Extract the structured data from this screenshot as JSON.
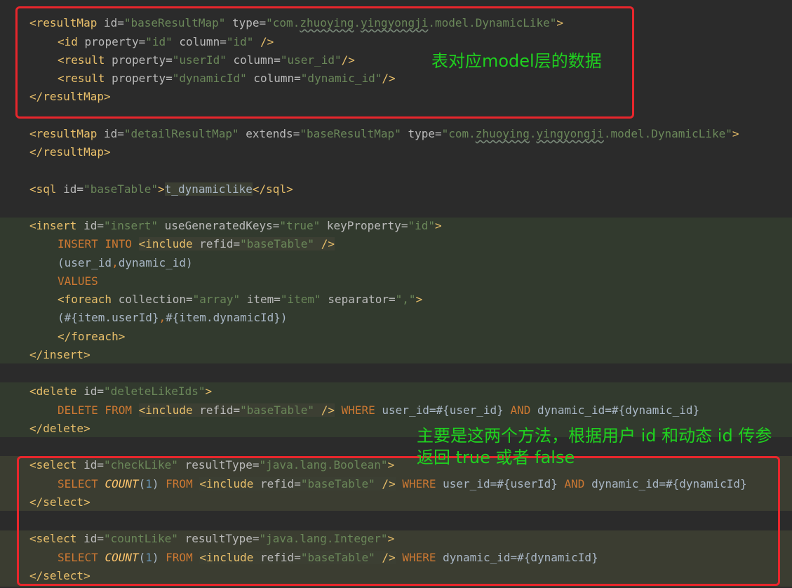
{
  "code_lines": {
    "l1": {
      "open": "<resultMap",
      "id_attr": " id=",
      "id_val": "\"baseResultMap\"",
      "type_attr": " type=",
      "type_val_a": "\"com.",
      "type_sq1": "zhuoying",
      "type_dot1": ".",
      "type_sq2": "yingyongji",
      "type_val_b": ".model.DynamicLike\"",
      "close": ">"
    },
    "l2": {
      "open": "<id",
      "p_attr": " property=",
      "p_val": "\"id\"",
      "c_attr": " column=",
      "c_val": "\"id\"",
      "close": " />"
    },
    "l3": {
      "open": "<result",
      "p_attr": " property=",
      "p_val": "\"userId\"",
      "c_attr": " column=",
      "c_val": "\"user_id\"",
      "close": "/>"
    },
    "l4": {
      "open": "<result",
      "p_attr": " property=",
      "p_val": "\"dynamicId\"",
      "c_attr": " column=",
      "c_val": "\"dynamic_id\"",
      "close": "/>"
    },
    "l5": {
      "text": "</resultMap>"
    },
    "l6": {
      "open": "<resultMap",
      "id_attr": " id=",
      "id_val": "\"detailResultMap\"",
      "ext_attr": " extends=",
      "ext_val": "\"baseResultMap\"",
      "type_attr": " type=",
      "type_val_a": "\"com.",
      "type_sq1": "zhuoying",
      "type_dot1": ".",
      "type_sq2": "yingyongji",
      "type_val_b": ".model.DynamicLike\"",
      "close": ">"
    },
    "l7": {
      "text": "</resultMap>"
    },
    "l8": {
      "open": "<sql",
      "id_attr": " id=",
      "id_val": "\"baseTable\"",
      "close": ">",
      "body": "t_dynamiclike",
      "end": "</sql>"
    },
    "l9": {
      "open": "<insert",
      "id_attr": " id=",
      "id_val": "\"insert\"",
      "ugk_attr": " useGeneratedKeys=",
      "ugk_val": "\"true\"",
      "kp_attr": " keyProperty=",
      "kp_val": "\"id\"",
      "close": ">"
    },
    "l10": {
      "kw": "INSERT INTO ",
      "inc": "<include",
      "ref_attr": " refid=",
      "ref_val": "\"baseTable\"",
      "close": " />"
    },
    "l11": {
      "a": "(user_id",
      "comma": ",",
      "b": "dynamic_id)"
    },
    "l12": {
      "kw": "VALUES"
    },
    "l13": {
      "open": "<foreach",
      "col_attr": " collection=",
      "col_val": "\"array\"",
      "item_attr": " item=",
      "item_val": "\"item\"",
      "sep_attr": " separator=",
      "sep_val": "\",\"",
      "close": ">"
    },
    "l14": {
      "a": "(#{item.userId}",
      "comma": ",",
      "b": "#{item.dynamicId})"
    },
    "l15": {
      "text": "</foreach>"
    },
    "l16": {
      "text": "</insert>"
    },
    "l17": {
      "open": "<delete",
      "id_attr": " id=",
      "id_val": "\"deleteLikeIds\"",
      "close": ">"
    },
    "l18": {
      "kw1": "DELETE FROM ",
      "inc": "<include",
      "ref_attr": " refid=",
      "ref_val": "\"baseTable\"",
      "close": " />",
      "kw2": " WHERE ",
      "c1": "user_id=#{user_id} ",
      "kw3": "AND ",
      "c2": "dynamic_id=#{dynamic_id}"
    },
    "l19": {
      "text": "</delete>"
    },
    "l20": {
      "open": "<select",
      "id_attr": " id=",
      "id_val": "\"checkLike\"",
      "rt_attr": " resultType=",
      "rt_val": "\"java.lang.Boolean\"",
      "close": ">"
    },
    "l21": {
      "kw1": "SELECT ",
      "fn": "COUNT",
      "lp": "(",
      "num": "1",
      "rp": ")",
      "kw2": " FROM ",
      "inc": "<include",
      "ref_attr": " refid=",
      "ref_val": "\"baseTable\"",
      "close": " />",
      "kw3": " WHERE ",
      "c1": "user_id=#{userId} ",
      "kw4": "AND ",
      "c2": "dynamic_id=#{dynamicId}"
    },
    "l22": {
      "text": "</select>"
    },
    "l23": {
      "open": "<select",
      "id_attr": " id=",
      "id_val": "\"countLike\"",
      "rt_attr": " resultType=",
      "rt_val": "\"java.lang.Integer\"",
      "close": ">"
    },
    "l24": {
      "kw1": "SELECT ",
      "fn": "COUNT",
      "lp": "(",
      "num": "1",
      "rp": ")",
      "kw2": " FROM ",
      "inc": "<include",
      "ref_attr": " refid=",
      "ref_val": "\"baseTable\"",
      "close": " />",
      "kw3": " WHERE ",
      "c1": "dynamic_id=#{dynamicId}"
    },
    "l25": {
      "text": "</select>"
    }
  },
  "annotations": {
    "note1": "表对应model层的数据",
    "note2_line1": "主要是这两个方法，根据用户 id 和动态 id 传参",
    "note2_line2": "返回 true 或者 false"
  },
  "colors": {
    "tag": "#e8bf6a",
    "attribute": "#bababa",
    "value": "#6a8759",
    "keyword": "#cc7832",
    "annotation_box": "#e8262c",
    "annotation_text": "#1fd11f"
  }
}
